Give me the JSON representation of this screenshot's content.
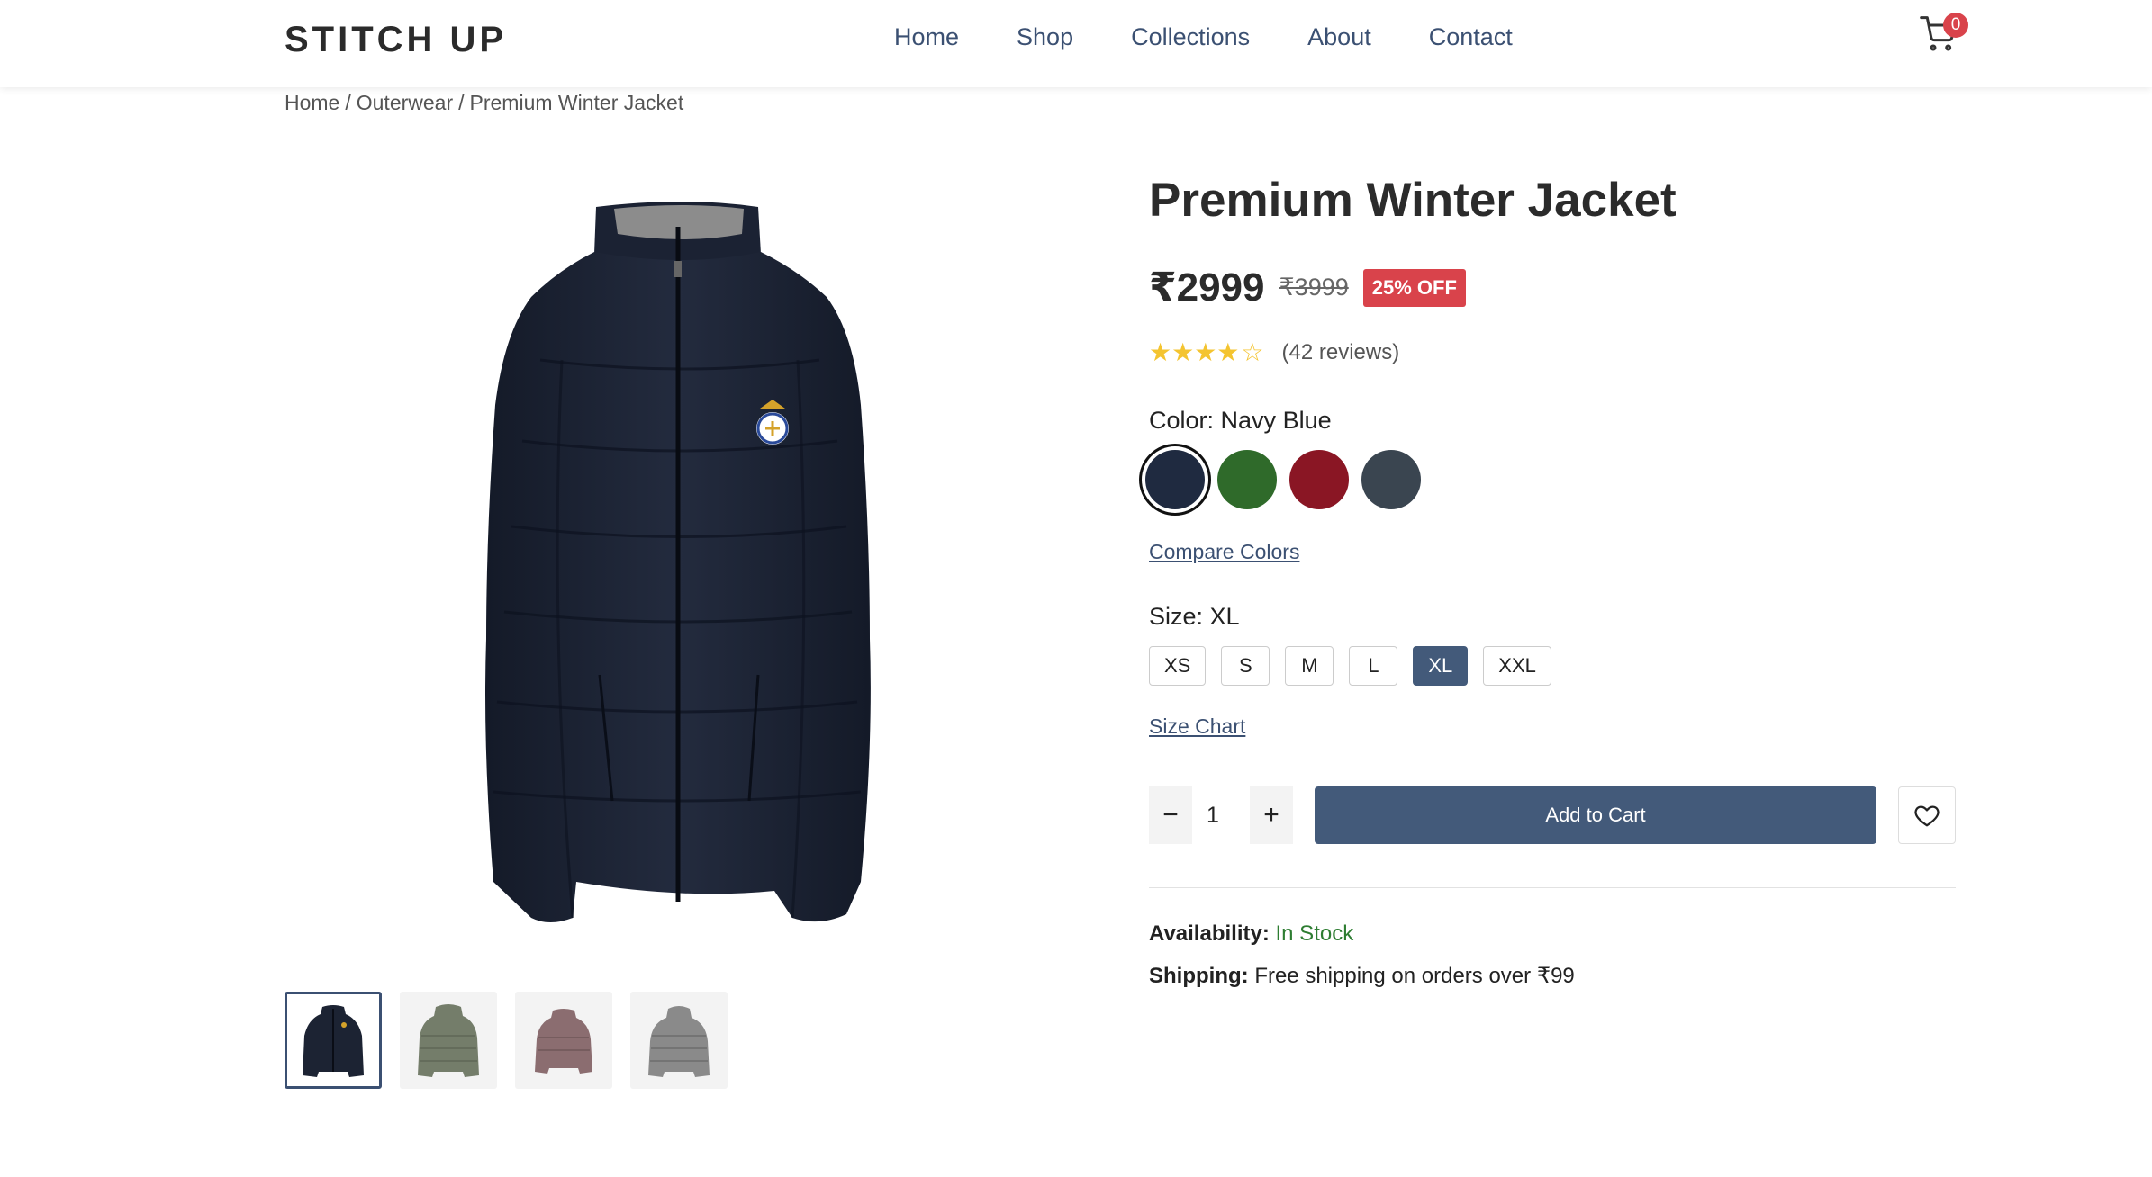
{
  "header": {
    "logo": "STITCH UP",
    "nav": [
      "Home",
      "Shop",
      "Collections",
      "About",
      "Contact"
    ],
    "cart_count": "0"
  },
  "breadcrumb": [
    "Home",
    "Outerwear",
    "Premium Winter Jacket"
  ],
  "gallery": {
    "thumbnail_colors": [
      "#1c2333",
      "#747d6a",
      "#8b6d70",
      "#8a8a8a"
    ],
    "active_index": 0
  },
  "product": {
    "title": "Premium Winter Jacket",
    "price": "₹2999",
    "old_price": "₹3999",
    "discount": "25% OFF",
    "rating": 4.5,
    "stars_filled": "★★★★",
    "star_outline": "☆",
    "reviews": "(42 reviews)",
    "color_label": "Color:",
    "color_value": "Navy Blue",
    "colors": [
      {
        "name": "Navy Blue",
        "hex": "#1f2a40"
      },
      {
        "name": "Green",
        "hex": "#2f6a2a"
      },
      {
        "name": "Maroon",
        "hex": "#8a1624"
      },
      {
        "name": "Charcoal",
        "hex": "#3a4550"
      }
    ],
    "compare_colors": "Compare Colors",
    "size_label": "Size:",
    "size_value": "XL",
    "sizes": [
      "XS",
      "S",
      "M",
      "L",
      "XL",
      "XXL"
    ],
    "size_chart": "Size Chart",
    "quantity": "1",
    "qty_minus": "−",
    "qty_plus": "+",
    "add_to_cart": "Add to Cart",
    "availability_label": "Availability:",
    "availability_value": "In Stock",
    "shipping_label": "Shipping:",
    "shipping_value": "Free shipping on orders over ₹99"
  },
  "icons": {
    "cart": "cart-icon",
    "wishlist": "heart-icon"
  },
  "colors": {
    "accent": "#435a7a",
    "nav_text": "#3b5072",
    "badge": "#d9434b",
    "in_stock": "#2e7d32"
  }
}
